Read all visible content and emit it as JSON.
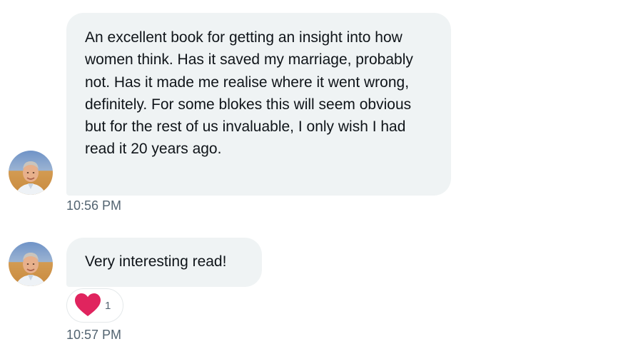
{
  "messages": [
    {
      "text": "An excellent book for getting an insight into how women think. Has it saved my marriage, probably not. Has it made me realise where it went wrong, definitely. For some blokes this will seem obvious but for the rest of us invaluable, I only wish I had read it 20 years ago.",
      "time": "10:56 PM"
    },
    {
      "text": "Very interesting read!",
      "time": "10:57 PM",
      "reaction": {
        "icon": "heart-icon",
        "count": "1",
        "color": "#e0245e"
      }
    }
  ],
  "colors": {
    "bubble_bg": "#eff3f4",
    "text": "#0f1419",
    "timestamp": "#536471"
  }
}
